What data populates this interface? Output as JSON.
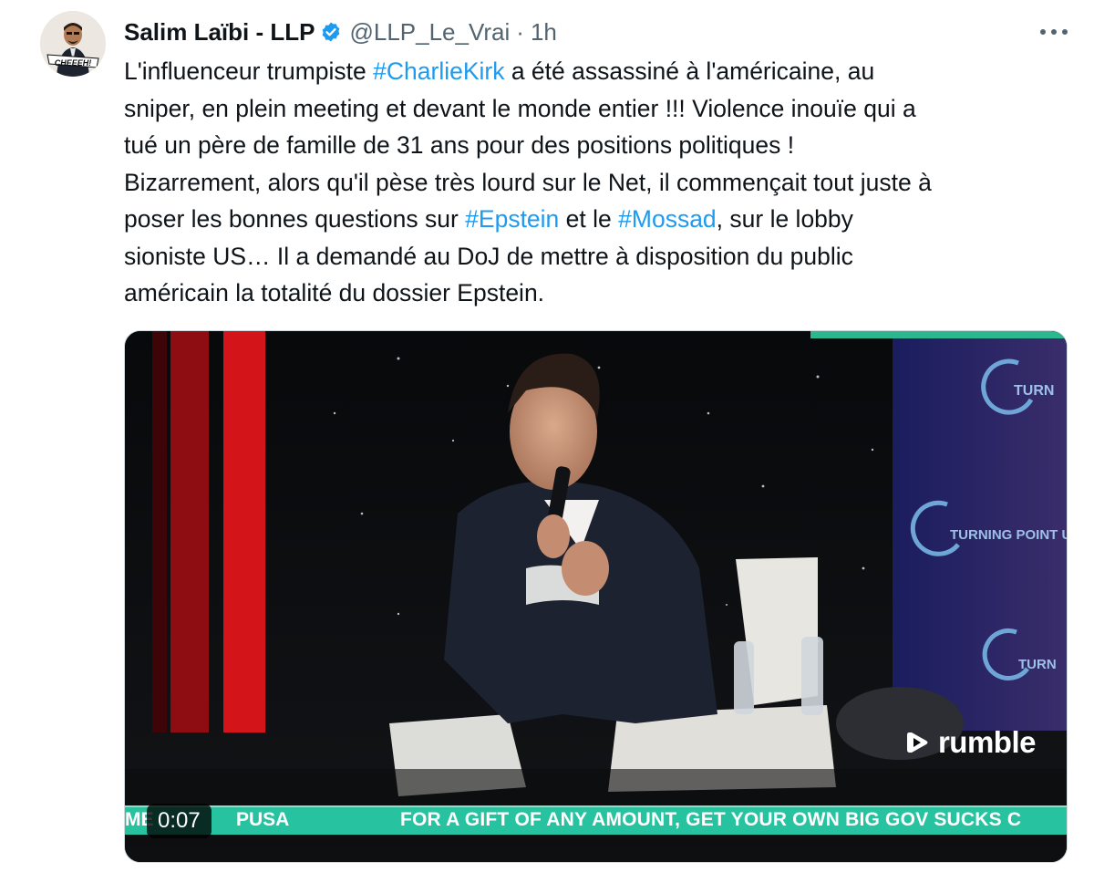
{
  "author": {
    "name": "Salim Laïbi - LLP",
    "handle": "@LLP_Le_Vrai",
    "separator": "·",
    "time": "1h",
    "avatar_caption": "CHEEEH!"
  },
  "icons": {
    "verified": "verified-badge-icon",
    "more": "more-options-icon",
    "video_logo": "rumble-logo-icon"
  },
  "colors": {
    "hashtag": "#1d9bf0",
    "verified": "#1d9bf0",
    "ticker": "#27c3a0"
  },
  "tweet": {
    "lines": [
      {
        "t1": "L'influenceur trumpiste ",
        "h1": "#CharlieKirk",
        "t2": " a été assassiné à l'américaine, au"
      },
      {
        "t1": "sniper, en plein meeting et devant le monde entier !!! Violence inouïe qui a"
      },
      {
        "t1": "tué un père de famille de 31 ans pour des positions politiques !"
      },
      {
        "t1": "Bizarrement, alors qu'il pèse très lourd sur le Net, il commençait tout juste à"
      },
      {
        "t1": "poser les bonnes questions sur ",
        "h1": "#Epstein",
        "t2": " et le ",
        "h2": "#Mossad",
        "t3": ", sur le lobby"
      },
      {
        "t1": "sioniste US… Il a demandé au DoJ de mettre à disposition du public"
      },
      {
        "t1": "américain la totalité du dossier Epstein."
      }
    ]
  },
  "media": {
    "timer": "0:07",
    "watermark": "rumble",
    "ticker_left": "ME",
    "ticker_left2": "PUSA",
    "ticker_text": "FOR A GIFT OF ANY AMOUNT, GET YOUR OWN BIG GOV SUCKS C",
    "banner_text_1": "TURNING POINT USA",
    "banner_text_2": "TURNING POINT USA",
    "banner_text_3": "TURN"
  }
}
